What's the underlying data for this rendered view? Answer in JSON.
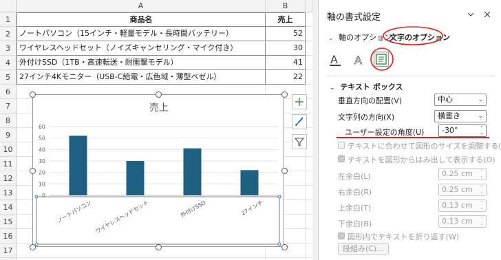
{
  "sheet": {
    "columns": [
      "A",
      "B"
    ],
    "rows": [
      "1",
      "2",
      "3",
      "4",
      "5",
      "6",
      "7",
      "8",
      "9",
      "10",
      "11",
      "12",
      "13",
      "14",
      "15",
      "16",
      "17",
      "18"
    ],
    "table": {
      "header": [
        "商品名",
        "売上"
      ],
      "data": [
        [
          "ノートパソコン（15インチ・軽量モデル・長時間バッテリー）",
          "52"
        ],
        [
          "ワイヤレスヘッドセット（ノイズキャンセリング・マイク付き）",
          "30"
        ],
        [
          "外付けSSD（1TB・高速転送・耐衝撃モデル）",
          "41"
        ],
        [
          "27インチ4Kモニター（USB-C給電・広色域・薄型ベゼル）",
          "22"
        ]
      ]
    }
  },
  "chart_data": {
    "type": "bar",
    "title": "売上",
    "categories": [
      "ノートパソコン",
      "ワイヤレスヘッドセット",
      "外付けSSD",
      "27インチ"
    ],
    "values": [
      52,
      30,
      41,
      22
    ],
    "ylim": [
      0,
      60
    ],
    "yticks": [
      "0",
      "10",
      "20",
      "30",
      "40",
      "50",
      "60"
    ],
    "grid": true,
    "label_angle": -30,
    "bar_color": "#1f5f82"
  },
  "chart_tools": [
    "plus-icon",
    "brush-icon",
    "filter-icon"
  ],
  "pane": {
    "title": "軸の書式設定",
    "tab_axis_options": "軸のオプション",
    "tab_text_options": "文字のオプション",
    "section_textbox": "テキスト ボックス",
    "vertical_align_label": "垂直方向の配置(V)",
    "vertical_align_value": "中心",
    "text_direction_label": "文字列の方向(X)",
    "text_direction_value": "横書き",
    "custom_angle_label": "ユーザー設定の角度(U)",
    "custom_angle_value": "-30°",
    "resize_shape_label": "テキストに合わせて図形のサイズを調整する(F)",
    "overflow_label": "テキストを図形からはみ出して表示する(O)",
    "left_margin_label": "左余白(L)",
    "left_margin_value": "0.25 cm",
    "right_margin_label": "右余白(R)",
    "right_margin_value": "0.25 cm",
    "top_margin_label": "上余白(T)",
    "top_margin_value": "0.13 cm",
    "bottom_margin_label": "下余白(B)",
    "bottom_margin_value": "0.13 cm",
    "wrap_label": "図形内でテキストを折り返す(W)",
    "columns_button": "段組み(C)...",
    "accent_color": "#e02020"
  }
}
